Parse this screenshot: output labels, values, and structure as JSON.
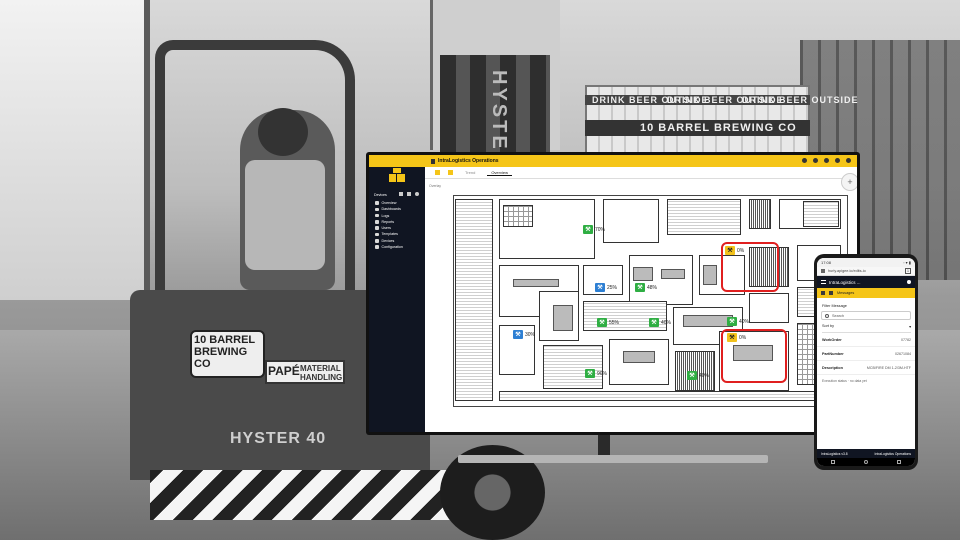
{
  "background": {
    "pallet_labels": [
      "DRINK BEER OUTSIDE",
      "DRINK BEER OUTSIDE",
      "DRINK BEER OUTSIDE"
    ],
    "pallet_brand": "10 BARREL BREWING CO",
    "mast_text": "HYSTER",
    "forklift_badge": "10 BARREL BREWING CO",
    "dealer_badge": "PAPÉ",
    "dealer_sub": "MATERIAL HANDLING",
    "model_text": "HYSTER 40"
  },
  "monitor": {
    "app_title": "IntraLogistics Operations",
    "sidebar": {
      "header": "Devices",
      "items": [
        {
          "label": "Overview"
        },
        {
          "label": "Dashboards"
        },
        {
          "label": "Logs"
        },
        {
          "label": "Reports"
        },
        {
          "label": "Users"
        },
        {
          "label": "Templates"
        },
        {
          "label": "Devices"
        },
        {
          "label": "Configuration"
        }
      ]
    },
    "tabs": [
      {
        "label": "Trend"
      },
      {
        "label": "Overview"
      }
    ],
    "breadcrumb": "Overlay",
    "fab_label": "+",
    "badges": [
      {
        "icon": "⚒",
        "color": "green",
        "text": "70%"
      },
      {
        "icon": "⚒",
        "color": "blue",
        "text": "25%"
      },
      {
        "icon": "⚒",
        "color": "green",
        "text": "48%"
      },
      {
        "icon": "⚒",
        "color": "yellow",
        "text": "0%"
      },
      {
        "icon": "⚒",
        "color": "green",
        "text": "55%"
      },
      {
        "icon": "⚒",
        "color": "green",
        "text": "40%"
      },
      {
        "icon": "⚒",
        "color": "green",
        "text": "40%"
      },
      {
        "icon": "⚒",
        "color": "blue",
        "text": "30%"
      },
      {
        "icon": "⚒",
        "color": "green",
        "text": "90%"
      },
      {
        "icon": "⚒",
        "color": "green",
        "text": "40%"
      },
      {
        "icon": "⚒",
        "color": "yellow",
        "text": "0%"
      }
    ]
  },
  "phone": {
    "time": "17:08",
    "status_icons": "◦ ▾ ▮",
    "url": "hurly.apigee.io/edits-io",
    "tab_count": "1",
    "title": "IntraLogistics ...",
    "tab_label": "Messages",
    "filter_label": "Filter Message",
    "search_placeholder": "Search",
    "sort_label": "Sort by",
    "sort_caret": "▾",
    "rows": [
      {
        "key": "WorkOrder",
        "value": "07782"
      },
      {
        "key": "PartNumber",
        "value": "02671084"
      },
      {
        "key": "Description",
        "value": "MCB/FIRE DM 1-2/3M-HTF"
      }
    ],
    "note": "Execution status · no data yet",
    "footer_left": "IntraLogistics v3.8",
    "footer_right": "IntraLogistics Operations"
  },
  "colors": {
    "accent": "#f5c518",
    "sidebar": "#101522",
    "highlight": "#e01f1f",
    "status_green": "#2fae43",
    "status_blue": "#2d7fd3"
  }
}
